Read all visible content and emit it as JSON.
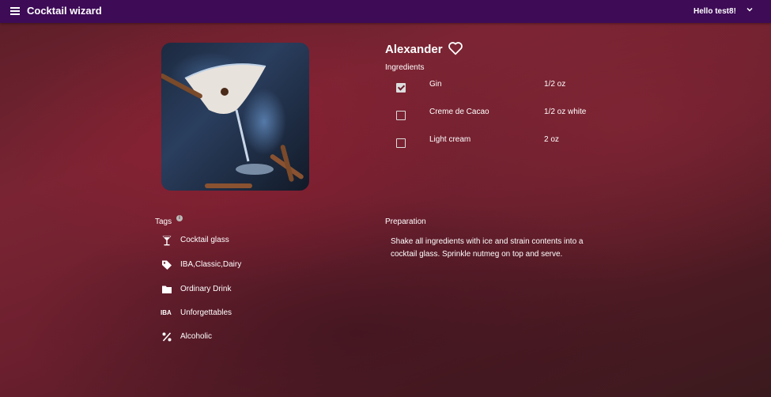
{
  "header": {
    "menu_icon": "hamburger-menu-icon",
    "title": "Cocktail wizard",
    "greeting": "Hello test8!",
    "account_chevron": "˅",
    "background_color": "#3e0b57"
  },
  "drink": {
    "name": "Alexander",
    "favorite_icon": "heart-outline-icon",
    "image_alt": "cocktail-photo"
  },
  "ingredients": {
    "label": "Ingredients",
    "items": [
      {
        "name": "Gin",
        "amount": "1/2 oz",
        "checked": true
      },
      {
        "name": "Creme de Cacao",
        "amount": "1/2 oz white",
        "checked": false
      },
      {
        "name": "Light cream",
        "amount": "2 oz",
        "checked": false
      }
    ]
  },
  "tags": {
    "label": "Tags",
    "info_icon": "info-icon",
    "items": [
      {
        "icon": "cocktail-glass-icon",
        "text": "Cocktail glass"
      },
      {
        "icon": "tag-icon",
        "text": "IBA,Classic,Dairy"
      },
      {
        "icon": "folder-icon",
        "text": "Ordinary Drink"
      },
      {
        "icon": "iba-icon",
        "icon_text": "IBA",
        "text": "Unforgettables"
      },
      {
        "icon": "percent-icon",
        "text": "Alcoholic"
      }
    ]
  },
  "preparation": {
    "label": "Preparation",
    "text": "Shake all ingredients with ice and strain contents into a cocktail glass. Sprinkle nutmeg on top and serve."
  }
}
